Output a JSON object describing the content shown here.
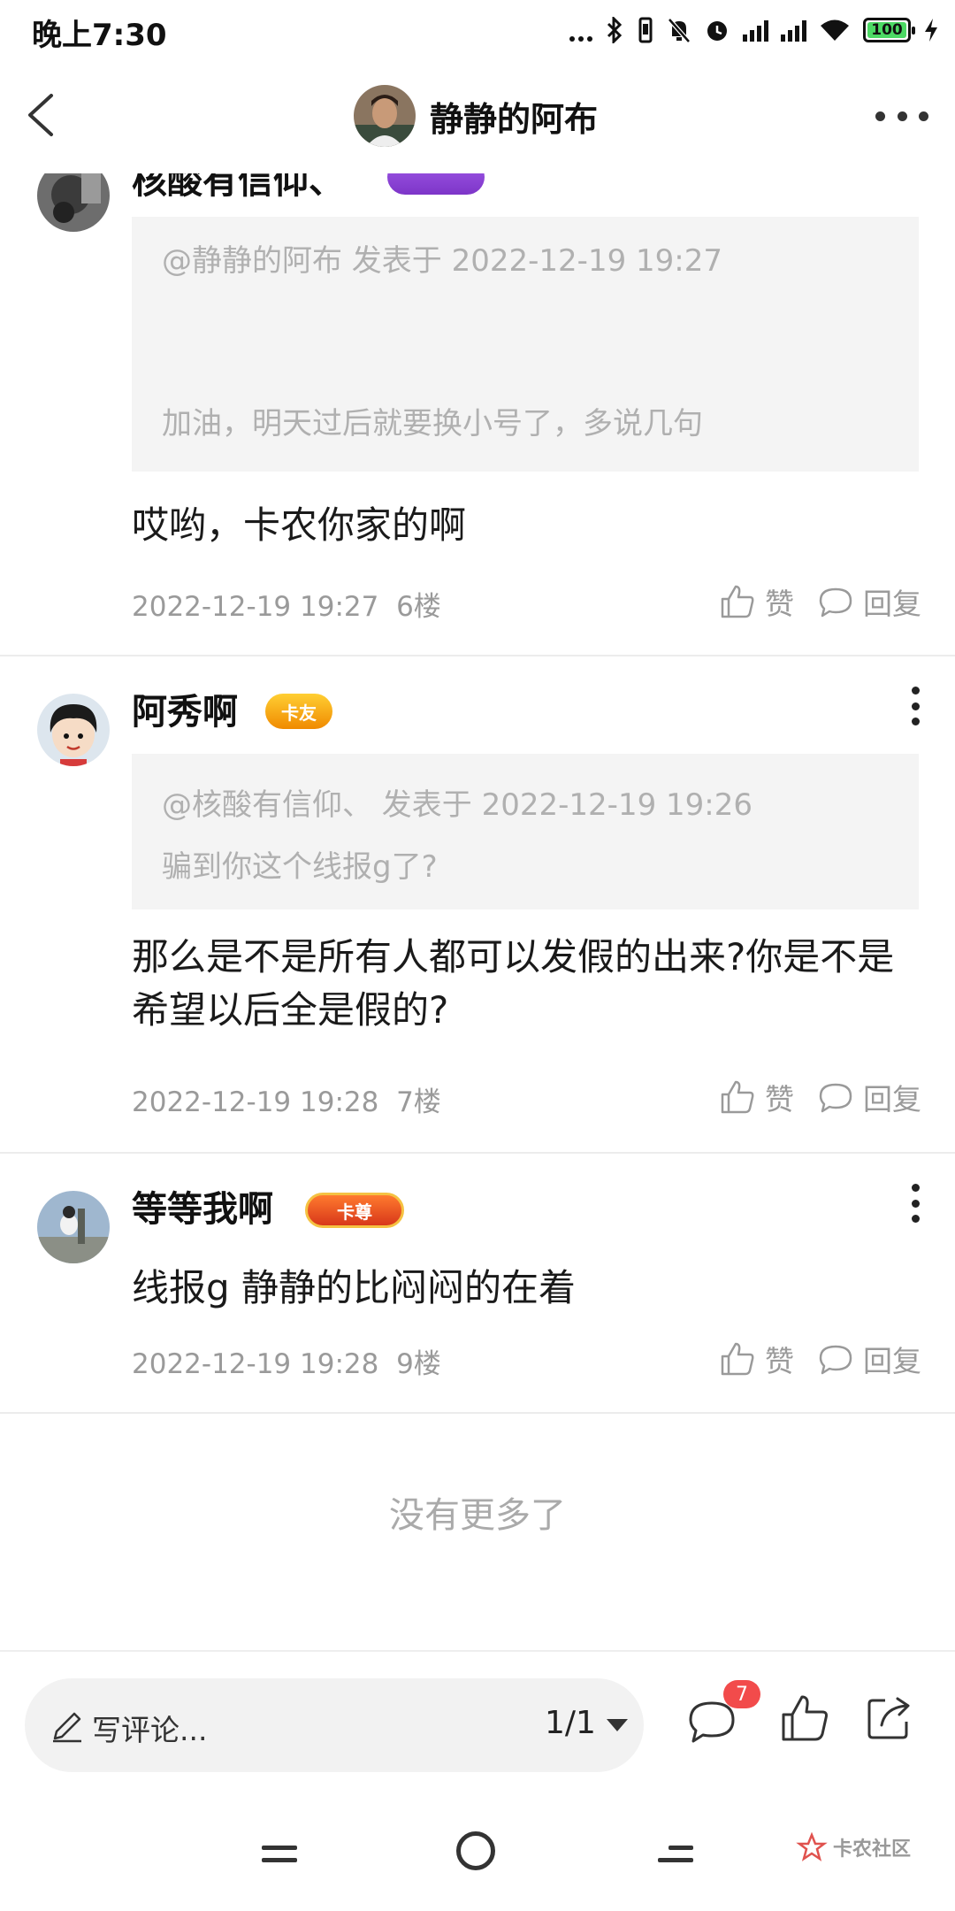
{
  "status_bar": {
    "time": "晚上7:30",
    "battery": "100",
    "icons": [
      "more-dots-icon",
      "bluetooth-icon",
      "vibrate-icon",
      "mute-icon",
      "alarm-icon",
      "signal-icon",
      "signal-icon",
      "wifi-icon",
      "battery-icon",
      "charging-icon"
    ]
  },
  "header": {
    "title": "静静的阿布",
    "back_icon": "chevron-left-icon",
    "more_icon": "more-horizontal-icon"
  },
  "comments": [
    {
      "author": "核酸有信仰、",
      "quote_meta": "@静静的阿布 发表于 2022-12-19 19:27",
      "quote_text": "加油，明天过后就要换小号了，多说几句",
      "body": "哎哟，卡农你家的啊",
      "time": "2022-12-19 19:27",
      "floor": "6楼",
      "like_label": "赞",
      "reply_label": "回复"
    },
    {
      "author": "阿秀啊",
      "badge": "卡友",
      "quote_meta": "@核酸有信仰、 发表于 2022-12-19 19:26",
      "quote_text": "骗到你这个线报g了?",
      "body": "那么是不是所有人都可以发假的出来?你是不是希望以后全是假的?",
      "time": "2022-12-19 19:28",
      "floor": "7楼",
      "like_label": "赞",
      "reply_label": "回复"
    },
    {
      "author": "等等我啊",
      "badge": "卡尊",
      "body": "线报g 静静的比闷闷的在着",
      "time": "2022-12-19 19:28",
      "floor": "9楼",
      "like_label": "赞",
      "reply_label": "回复"
    }
  ],
  "no_more_text": "没有更多了",
  "bottom_bar": {
    "placeholder": "写评论...",
    "page": "1/1",
    "comment_count": "7"
  },
  "nav_bar": {
    "watermark": "卡农社区"
  }
}
